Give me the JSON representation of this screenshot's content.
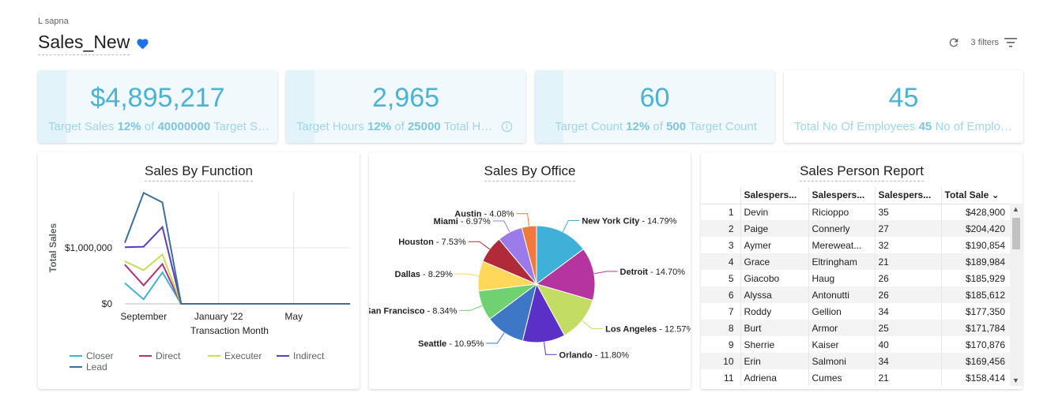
{
  "header": {
    "breadcrumb": "L sapna",
    "title": "Sales_New",
    "filters_label": "3 filters"
  },
  "kpis": [
    {
      "value": "$4,895,217",
      "label": "Target Sales",
      "pct": "12%",
      "of": "of",
      "target": "40000000",
      "rest": "Target Sales",
      "fill": 0.12
    },
    {
      "value": "2,965",
      "label": "Target Hours",
      "pct": "12%",
      "of": "of",
      "target": "25000",
      "rest": "Total Hours",
      "fill": 0.12
    },
    {
      "value": "60",
      "label": "Target Count",
      "pct": "12%",
      "of": "of",
      "target": "500",
      "rest": "Target Count",
      "fill": 0.12
    },
    {
      "value": "45",
      "label": "Total No Of Employees",
      "pct": "45",
      "of": "",
      "target": "",
      "rest": "No of Employees",
      "fill": 0
    }
  ],
  "chart_data": [
    {
      "type": "line",
      "title": "Sales By Function",
      "xlabel": "Transaction Month",
      "ylabel": "Total Sales",
      "x_ticks": [
        "September",
        "January '22",
        "May"
      ],
      "y_ticks": [
        "$0",
        "$1,000,000"
      ],
      "ylim": [
        0,
        2000000
      ],
      "x": [
        0,
        1,
        2,
        3,
        4,
        5,
        6,
        7,
        8,
        9,
        10,
        11,
        12
      ],
      "series": [
        {
          "name": "Closer",
          "color": "#3fb1d8",
          "values": [
            370000,
            80000,
            560000,
            0,
            0,
            0,
            0,
            0,
            0,
            0,
            0,
            0,
            0
          ]
        },
        {
          "name": "Direct",
          "color": "#b0337a",
          "values": [
            700000,
            330000,
            710000,
            0,
            0,
            0,
            0,
            0,
            0,
            0,
            0,
            0,
            0
          ]
        },
        {
          "name": "Executer",
          "color": "#c5dd5b",
          "values": [
            760000,
            600000,
            880000,
            0,
            0,
            0,
            0,
            0,
            0,
            0,
            0,
            0,
            0
          ]
        },
        {
          "name": "Indirect",
          "color": "#5a3fbf",
          "values": [
            1010000,
            1020000,
            1370000,
            0,
            0,
            0,
            0,
            0,
            0,
            0,
            0,
            0,
            0
          ]
        },
        {
          "name": "Lead",
          "color": "#3d6f99",
          "values": [
            1090000,
            1980000,
            1810000,
            0,
            0,
            0,
            0,
            0,
            0,
            0,
            0,
            0,
            0
          ]
        }
      ]
    },
    {
      "type": "pie",
      "title": "Sales By Office",
      "slices": [
        {
          "label": "New York City",
          "pct": 14.79,
          "color": "#3fb1d8"
        },
        {
          "label": "Detroit",
          "pct": 14.7,
          "color": "#b534a0"
        },
        {
          "label": "Los Angeles",
          "pct": 12.57,
          "color": "#c2dc64"
        },
        {
          "label": "Orlando",
          "pct": 11.8,
          "color": "#5a30c6"
        },
        {
          "label": "Seattle",
          "pct": 10.95,
          "color": "#3d77c6"
        },
        {
          "label": "San Francisco",
          "pct": 8.34,
          "color": "#6fd16f"
        },
        {
          "label": "Dallas",
          "pct": 8.29,
          "color": "#ffd75a"
        },
        {
          "label": "Houston",
          "pct": 7.53,
          "color": "#b02a3a"
        },
        {
          "label": "Miami",
          "pct": 6.97,
          "color": "#9b7bea"
        },
        {
          "label": "Austin",
          "pct": 4.08,
          "color": "#f07a3c"
        }
      ]
    }
  ],
  "report": {
    "title": "Sales Person Report",
    "columns": [
      "Salespers...",
      "Salespers...",
      "Salespers...",
      "Total Sale"
    ],
    "rows": [
      [
        "1",
        "Devin",
        "Ricioppo",
        "35",
        "$428,900"
      ],
      [
        "2",
        "Paige",
        "Connerly",
        "27",
        "$204,420"
      ],
      [
        "3",
        "Aymer",
        "Mereweat...",
        "32",
        "$190,854"
      ],
      [
        "4",
        "Grace",
        "Eltringham",
        "21",
        "$189,984"
      ],
      [
        "5",
        "Giacobo",
        "Haug",
        "26",
        "$185,929"
      ],
      [
        "6",
        "Alyssa",
        "Antonutti",
        "26",
        "$185,612"
      ],
      [
        "7",
        "Roddy",
        "Gellion",
        "34",
        "$177,350"
      ],
      [
        "8",
        "Burt",
        "Armor",
        "25",
        "$171,784"
      ],
      [
        "9",
        "Sherrie",
        "Kaiser",
        "40",
        "$170,876"
      ],
      [
        "10",
        "Erin",
        "Salmoni",
        "34",
        "$169,456"
      ],
      [
        "11",
        "Adriena",
        "Cumes",
        "21",
        "$158,414"
      ]
    ]
  }
}
